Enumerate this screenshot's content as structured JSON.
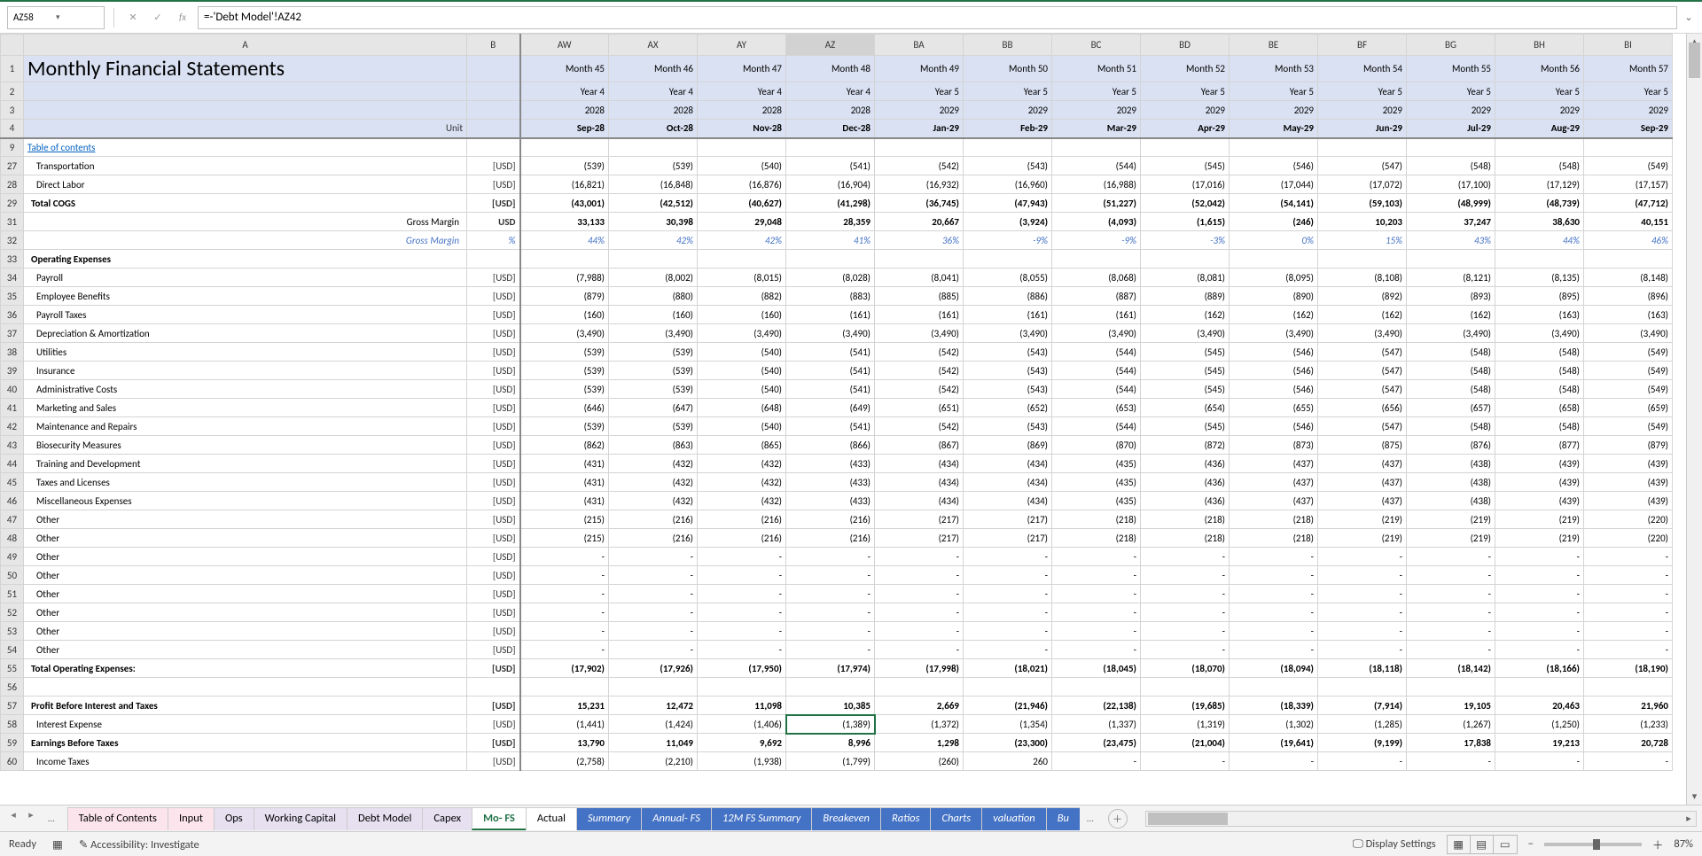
{
  "nameBox": "AZ58",
  "formulaBar": "=-'Debt Model'!AZ42",
  "title": "Monthly Financial Statements",
  "unitLabel": "Unit",
  "tocLabel": "Table of contents",
  "cols": [
    "AW",
    "AX",
    "AY",
    "AZ",
    "BA",
    "BB",
    "BC",
    "BD",
    "BE",
    "BF",
    "BG",
    "BH",
    "BI"
  ],
  "monthRow": [
    "Month 45",
    "Month 46",
    "Month 47",
    "Month 48",
    "Month 49",
    "Month 50",
    "Month 51",
    "Month 52",
    "Month 53",
    "Month 54",
    "Month 55",
    "Month 56",
    "Month 57"
  ],
  "yearRow": [
    "Year 4",
    "Year 4",
    "Year 4",
    "Year 4",
    "Year 5",
    "Year 5",
    "Year 5",
    "Year 5",
    "Year 5",
    "Year 5",
    "Year 5",
    "Year 5",
    "Year 5"
  ],
  "calYear": [
    "2028",
    "2028",
    "2028",
    "2028",
    "2029",
    "2029",
    "2029",
    "2029",
    "2029",
    "2029",
    "2029",
    "2029",
    "2029"
  ],
  "dateRow": [
    "Sep-28",
    "Oct-28",
    "Nov-28",
    "Dec-28",
    "Jan-29",
    "Feb-29",
    "Mar-29",
    "Apr-29",
    "May-29",
    "Jun-29",
    "Jul-29",
    "Aug-29",
    "Sep-29"
  ],
  "rows": [
    {
      "n": 27,
      "a": "Transportation",
      "u": "[USD]",
      "v": [
        "(539)",
        "(539)",
        "(540)",
        "(541)",
        "(542)",
        "(543)",
        "(544)",
        "(545)",
        "(546)",
        "(547)",
        "(548)",
        "(548)",
        "(549)"
      ]
    },
    {
      "n": 28,
      "a": "Direct Labor",
      "u": "[USD]",
      "v": [
        "(16,821)",
        "(16,848)",
        "(16,876)",
        "(16,904)",
        "(16,932)",
        "(16,960)",
        "(16,988)",
        "(17,016)",
        "(17,044)",
        "(17,072)",
        "(17,100)",
        "(17,129)",
        "(17,157)"
      ]
    },
    {
      "n": 29,
      "a": "Total COGS",
      "u": "[USD]",
      "bold": true,
      "v": [
        "(43,001)",
        "(42,512)",
        "(40,627)",
        "(41,298)",
        "(36,745)",
        "(47,943)",
        "(51,227)",
        "(52,042)",
        "(54,141)",
        "(59,103)",
        "(48,999)",
        "(48,739)",
        "(47,712)"
      ]
    },
    {
      "n": 31,
      "a": "Gross Margin",
      "right": true,
      "u": "USD",
      "bold": true,
      "top": true,
      "v": [
        "33,133",
        "30,398",
        "29,048",
        "28,359",
        "20,667",
        "(3,924)",
        "(4,093)",
        "(1,615)",
        "(246)",
        "10,203",
        "37,247",
        "38,630",
        "40,151"
      ]
    },
    {
      "n": 32,
      "a": "Gross Margin",
      "right": true,
      "u": "%",
      "blue": true,
      "v": [
        "44%",
        "42%",
        "42%",
        "41%",
        "36%",
        "-9%",
        "-9%",
        "-3%",
        "0%",
        "15%",
        "43%",
        "44%",
        "46%"
      ]
    },
    {
      "n": 33,
      "a": "Operating Expenses",
      "bold": true,
      "u": "",
      "v": [
        "",
        "",
        "",
        "",
        "",
        "",
        "",
        "",
        "",
        "",
        "",
        "",
        ""
      ]
    },
    {
      "n": 34,
      "a": "Payroll",
      "u": "[USD]",
      "v": [
        "(7,988)",
        "(8,002)",
        "(8,015)",
        "(8,028)",
        "(8,041)",
        "(8,055)",
        "(8,068)",
        "(8,081)",
        "(8,095)",
        "(8,108)",
        "(8,121)",
        "(8,135)",
        "(8,148)"
      ]
    },
    {
      "n": 35,
      "a": "Employee Benefits",
      "u": "[USD]",
      "v": [
        "(879)",
        "(880)",
        "(882)",
        "(883)",
        "(885)",
        "(886)",
        "(887)",
        "(889)",
        "(890)",
        "(892)",
        "(893)",
        "(895)",
        "(896)"
      ]
    },
    {
      "n": 36,
      "a": "Payroll Taxes",
      "u": "[USD]",
      "v": [
        "(160)",
        "(160)",
        "(160)",
        "(161)",
        "(161)",
        "(161)",
        "(161)",
        "(162)",
        "(162)",
        "(162)",
        "(162)",
        "(163)",
        "(163)"
      ]
    },
    {
      "n": 37,
      "a": "Depreciation & Amortization",
      "u": "[USD]",
      "v": [
        "(3,490)",
        "(3,490)",
        "(3,490)",
        "(3,490)",
        "(3,490)",
        "(3,490)",
        "(3,490)",
        "(3,490)",
        "(3,490)",
        "(3,490)",
        "(3,490)",
        "(3,490)",
        "(3,490)"
      ]
    },
    {
      "n": 38,
      "a": "Utilities",
      "u": "[USD]",
      "v": [
        "(539)",
        "(539)",
        "(540)",
        "(541)",
        "(542)",
        "(543)",
        "(544)",
        "(545)",
        "(546)",
        "(547)",
        "(548)",
        "(548)",
        "(549)"
      ]
    },
    {
      "n": 39,
      "a": "Insurance",
      "u": "[USD]",
      "v": [
        "(539)",
        "(539)",
        "(540)",
        "(541)",
        "(542)",
        "(543)",
        "(544)",
        "(545)",
        "(546)",
        "(547)",
        "(548)",
        "(548)",
        "(549)"
      ]
    },
    {
      "n": 40,
      "a": "Administrative Costs",
      "u": "[USD]",
      "v": [
        "(539)",
        "(539)",
        "(540)",
        "(541)",
        "(542)",
        "(543)",
        "(544)",
        "(545)",
        "(546)",
        "(547)",
        "(548)",
        "(548)",
        "(549)"
      ]
    },
    {
      "n": 41,
      "a": "Marketing and Sales",
      "u": "[USD]",
      "v": [
        "(646)",
        "(647)",
        "(648)",
        "(649)",
        "(651)",
        "(652)",
        "(653)",
        "(654)",
        "(655)",
        "(656)",
        "(657)",
        "(658)",
        "(659)"
      ]
    },
    {
      "n": 42,
      "a": "Maintenance and Repairs",
      "u": "[USD]",
      "v": [
        "(539)",
        "(539)",
        "(540)",
        "(541)",
        "(542)",
        "(543)",
        "(544)",
        "(545)",
        "(546)",
        "(547)",
        "(548)",
        "(548)",
        "(549)"
      ]
    },
    {
      "n": 43,
      "a": "Biosecurity Measures",
      "u": "[USD]",
      "v": [
        "(862)",
        "(863)",
        "(865)",
        "(866)",
        "(867)",
        "(869)",
        "(870)",
        "(872)",
        "(873)",
        "(875)",
        "(876)",
        "(877)",
        "(879)"
      ]
    },
    {
      "n": 44,
      "a": "Training and Development",
      "u": "[USD]",
      "v": [
        "(431)",
        "(432)",
        "(432)",
        "(433)",
        "(434)",
        "(434)",
        "(435)",
        "(436)",
        "(437)",
        "(437)",
        "(438)",
        "(439)",
        "(439)"
      ]
    },
    {
      "n": 45,
      "a": "Taxes and Licenses",
      "u": "[USD]",
      "v": [
        "(431)",
        "(432)",
        "(432)",
        "(433)",
        "(434)",
        "(434)",
        "(435)",
        "(436)",
        "(437)",
        "(437)",
        "(438)",
        "(439)",
        "(439)"
      ]
    },
    {
      "n": 46,
      "a": "Miscellaneous Expenses",
      "u": "[USD]",
      "v": [
        "(431)",
        "(432)",
        "(432)",
        "(433)",
        "(434)",
        "(434)",
        "(435)",
        "(436)",
        "(437)",
        "(437)",
        "(438)",
        "(439)",
        "(439)"
      ]
    },
    {
      "n": 47,
      "a": "Other",
      "u": "[USD]",
      "v": [
        "(215)",
        "(216)",
        "(216)",
        "(216)",
        "(217)",
        "(217)",
        "(218)",
        "(218)",
        "(218)",
        "(219)",
        "(219)",
        "(219)",
        "(220)"
      ]
    },
    {
      "n": 48,
      "a": "Other",
      "u": "[USD]",
      "v": [
        "(215)",
        "(216)",
        "(216)",
        "(216)",
        "(217)",
        "(217)",
        "(218)",
        "(218)",
        "(218)",
        "(219)",
        "(219)",
        "(219)",
        "(220)"
      ]
    },
    {
      "n": 49,
      "a": "Other",
      "u": "[USD]",
      "v": [
        "-",
        "-",
        "-",
        "-",
        "-",
        "-",
        "-",
        "-",
        "-",
        "-",
        "-",
        "-",
        "-"
      ]
    },
    {
      "n": 50,
      "a": "Other",
      "u": "[USD]",
      "v": [
        "-",
        "-",
        "-",
        "-",
        "-",
        "-",
        "-",
        "-",
        "-",
        "-",
        "-",
        "-",
        "-"
      ]
    },
    {
      "n": 51,
      "a": "Other",
      "u": "[USD]",
      "v": [
        "-",
        "-",
        "-",
        "-",
        "-",
        "-",
        "-",
        "-",
        "-",
        "-",
        "-",
        "-",
        "-"
      ]
    },
    {
      "n": 52,
      "a": "Other",
      "u": "[USD]",
      "v": [
        "-",
        "-",
        "-",
        "-",
        "-",
        "-",
        "-",
        "-",
        "-",
        "-",
        "-",
        "-",
        "-"
      ]
    },
    {
      "n": 53,
      "a": "Other",
      "u": "[USD]",
      "v": [
        "-",
        "-",
        "-",
        "-",
        "-",
        "-",
        "-",
        "-",
        "-",
        "-",
        "-",
        "-",
        "-"
      ]
    },
    {
      "n": 54,
      "a": "Other",
      "u": "[USD]",
      "v": [
        "-",
        "-",
        "-",
        "-",
        "-",
        "-",
        "-",
        "-",
        "-",
        "-",
        "-",
        "-",
        "-"
      ]
    },
    {
      "n": 55,
      "a": "Total Operating Expenses:",
      "u": "[USD]",
      "bold": true,
      "v": [
        "(17,902)",
        "(17,926)",
        "(17,950)",
        "(17,974)",
        "(17,998)",
        "(18,021)",
        "(18,045)",
        "(18,070)",
        "(18,094)",
        "(18,118)",
        "(18,142)",
        "(18,166)",
        "(18,190)"
      ]
    },
    {
      "n": 56,
      "a": "",
      "u": "",
      "v": [
        "",
        "",
        "",
        "",
        "",
        "",
        "",
        "",
        "",
        "",
        "",
        "",
        ""
      ]
    },
    {
      "n": 57,
      "a": "Profit Before Interest and Taxes",
      "u": "[USD]",
      "bold": true,
      "top": true,
      "v": [
        "15,231",
        "12,472",
        "11,098",
        "10,385",
        "2,669",
        "(21,946)",
        "(22,138)",
        "(19,685)",
        "(18,339)",
        "(7,914)",
        "19,105",
        "20,463",
        "21,960"
      ]
    },
    {
      "n": 58,
      "a": "Interest Expense",
      "u": "[USD]",
      "active": 3,
      "v": [
        "(1,441)",
        "(1,424)",
        "(1,406)",
        "(1,389)",
        "(1,372)",
        "(1,354)",
        "(1,337)",
        "(1,319)",
        "(1,302)",
        "(1,285)",
        "(1,267)",
        "(1,250)",
        "(1,233)"
      ]
    },
    {
      "n": 59,
      "a": "Earnings Before Taxes",
      "u": "[USD]",
      "bold": true,
      "v": [
        "13,790",
        "11,049",
        "9,692",
        "8,996",
        "1,298",
        "(23,300)",
        "(23,475)",
        "(21,004)",
        "(19,641)",
        "(9,199)",
        "17,838",
        "19,213",
        "20,728"
      ]
    },
    {
      "n": 60,
      "a": "Income Taxes",
      "u": "[USD]",
      "v": [
        "(2,758)",
        "(2,210)",
        "(1,938)",
        "(1,799)",
        "(260)",
        "260",
        "-",
        "-",
        "-",
        "-",
        "-",
        "-",
        "-"
      ]
    }
  ],
  "sheets": [
    {
      "name": "Table of Contents",
      "cls": "pink"
    },
    {
      "name": "Input",
      "cls": "pink"
    },
    {
      "name": "Ops",
      "cls": "lav"
    },
    {
      "name": "Working Capital",
      "cls": "lav"
    },
    {
      "name": "Debt Model",
      "cls": "lav"
    },
    {
      "name": "Capex",
      "cls": "lav"
    },
    {
      "name": "Mo- FS",
      "cls": "active"
    },
    {
      "name": "Actual",
      "cls": ""
    },
    {
      "name": "Summary",
      "cls": "blue"
    },
    {
      "name": "Annual- FS",
      "cls": "blue"
    },
    {
      "name": "12M FS Summary",
      "cls": "blue"
    },
    {
      "name": "Breakeven",
      "cls": "blue"
    },
    {
      "name": "Ratios",
      "cls": "blue"
    },
    {
      "name": "Charts",
      "cls": "blue"
    },
    {
      "name": "valuation",
      "cls": "blue"
    },
    {
      "name": "Bu",
      "cls": "blue"
    }
  ],
  "status": {
    "ready": "Ready",
    "access": "Accessibility: Investigate",
    "display": "Display Settings",
    "zoom": "87%"
  }
}
